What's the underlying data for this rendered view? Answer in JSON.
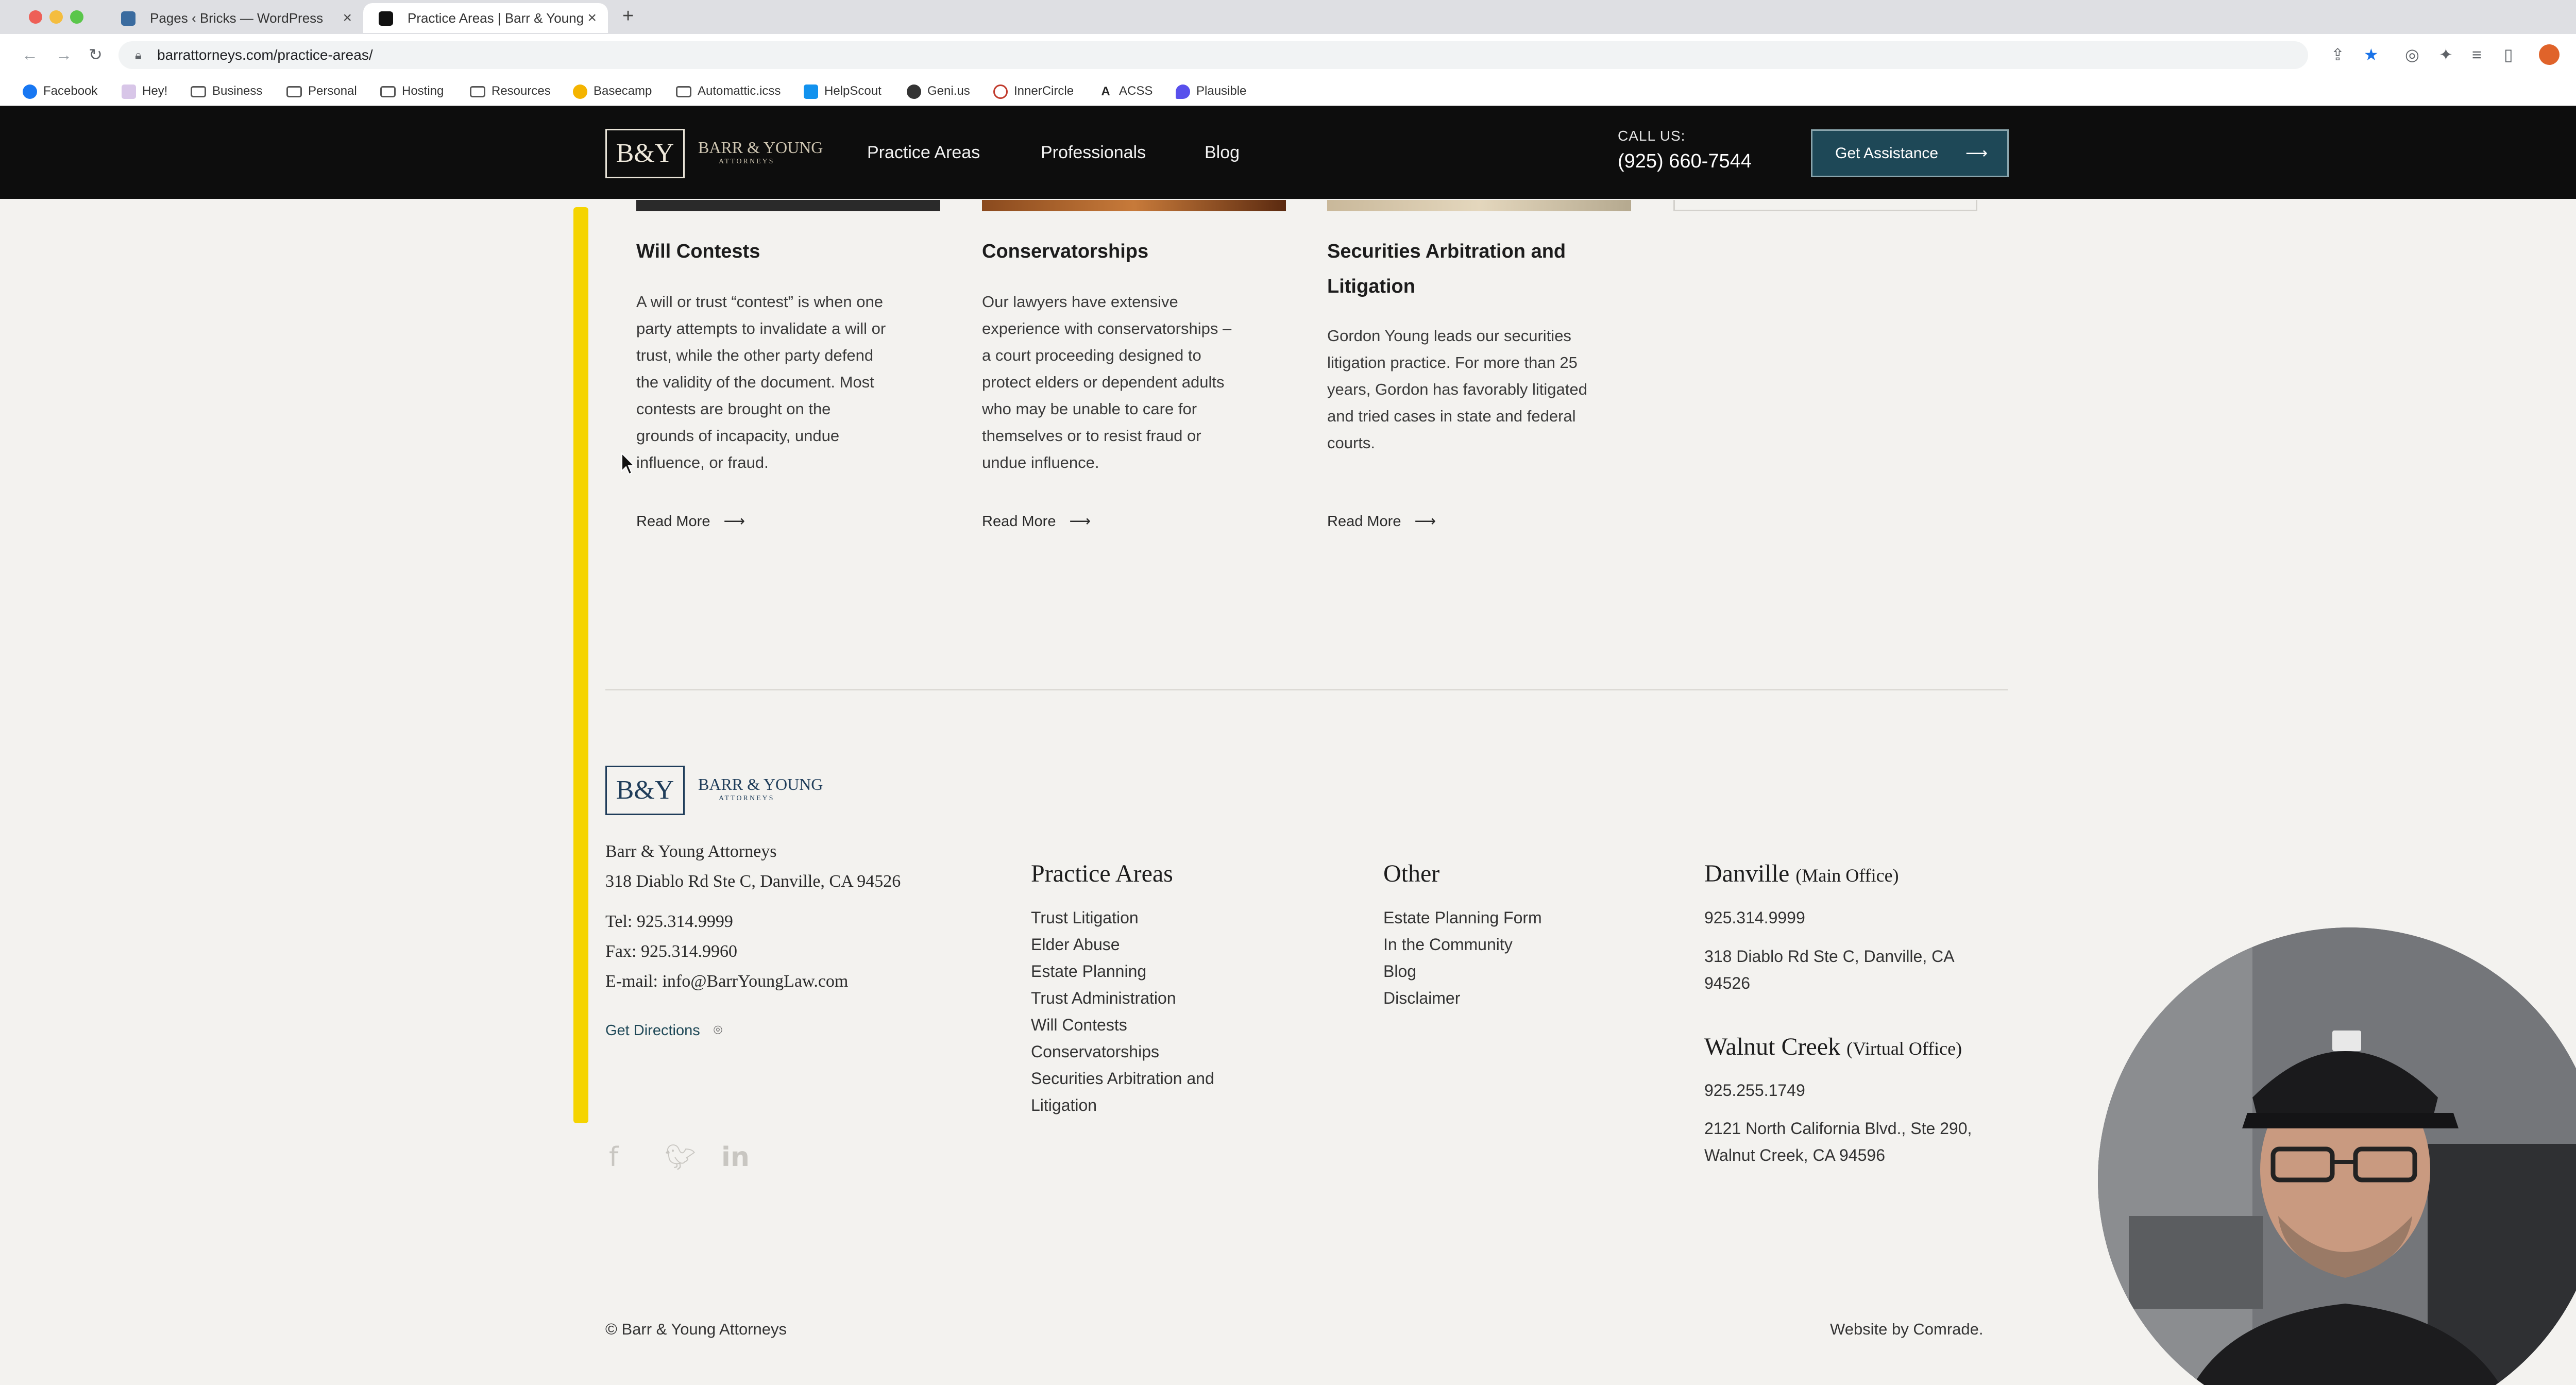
{
  "browser": {
    "tabs": [
      {
        "title": "Pages ‹ Bricks — WordPress",
        "active": false
      },
      {
        "title": "Practice Areas | Barr & Young",
        "active": true
      }
    ],
    "new_tab": "+",
    "url": "barrattorneys.com/practice-areas/",
    "bookmarks": [
      "Facebook",
      "Hey!",
      "Business",
      "Personal",
      "Hosting",
      "Resources",
      "Basecamp",
      "Automattic.icss",
      "HelpScout",
      "Geni.us",
      "InnerCircle",
      "ACSS",
      "Plausible"
    ]
  },
  "header": {
    "logo_mark": "B&Y",
    "logo_name": "BARR & YOUNG",
    "logo_sub": "ATTORNEYS",
    "nav": [
      "Practice Areas",
      "Professionals",
      "Blog"
    ],
    "call_label": "CALL US:",
    "phone": "(925) 660-7544",
    "cta": "Get Assistance",
    "cta_arrow": "⟶"
  },
  "cards": [
    {
      "title": "Will Contests",
      "body_lines": [
        "A will or trust “contest” is when one",
        "party attempts to invalidate a will or",
        "trust, while the other party defend",
        "the validity of the document. Most",
        "contests are brought on the",
        "grounds of incapacity, undue",
        "influence, or fraud."
      ],
      "link": "Read More"
    },
    {
      "title": "Conservatorships",
      "body_lines": [
        "Our lawyers have extensive",
        "experience with conservatorships –",
        "a court proceeding designed to",
        "protect elders or dependent adults",
        "who may be unable to care for",
        "themselves or to resist fraud or",
        "undue influence."
      ],
      "link": "Read More"
    },
    {
      "title_lines": [
        "Securities Arbitration and",
        "Litigation"
      ],
      "body_lines": [
        "Gordon Young leads our securities",
        "litigation practice. For more than 25",
        "years, Gordon has favorably litigated",
        "and tried cases in state and federal",
        "courts."
      ],
      "link": "Read More"
    }
  ],
  "footer": {
    "logo_mark": "B&Y",
    "logo_name": "BARR & YOUNG",
    "logo_sub": "ATTORNEYS",
    "firm_name": "Barr & Young Attorneys",
    "address": "318 Diablo Rd Ste C, Danville, CA 94526",
    "tel": "Tel: 925.314.9999",
    "fax": "Fax: 925.314.9960",
    "email": "E-mail: info@BarrYoungLaw.com",
    "directions": "Get Directions",
    "practice_title": "Practice Areas",
    "practice_links": [
      "Trust Litigation",
      "Elder Abuse",
      "Estate Planning",
      "Trust Administration",
      "Will Contests",
      "Conservatorships",
      "Securities Arbitration and",
      "Litigation"
    ],
    "other_title": "Other",
    "other_links": [
      "Estate Planning Form",
      "In the Community",
      "Blog",
      "Disclaimer"
    ],
    "danville": {
      "city": "Danville",
      "type": "(Main Office)",
      "phone": "925.314.9999",
      "address_lines": [
        "318 Diablo Rd Ste C, Danville, CA",
        "94526"
      ]
    },
    "walnut": {
      "city": "Walnut Creek",
      "type": "(Virtual Office)",
      "phone": "925.255.1749",
      "address_lines": [
        "2121 North California Blvd., Ste 290,",
        "Walnut Creek, CA 94596"
      ]
    },
    "social": [
      "facebook-icon",
      "twitter-icon",
      "linkedin-icon"
    ],
    "copyright": "© Barr & Young Attorneys",
    "credit": "Website by Comrade."
  },
  "colors": {
    "header_bg": "#0d0d0d",
    "cta_bg": "#1e4857",
    "accent_bar": "#f5d400",
    "page_bg": "#f3f2ef"
  }
}
